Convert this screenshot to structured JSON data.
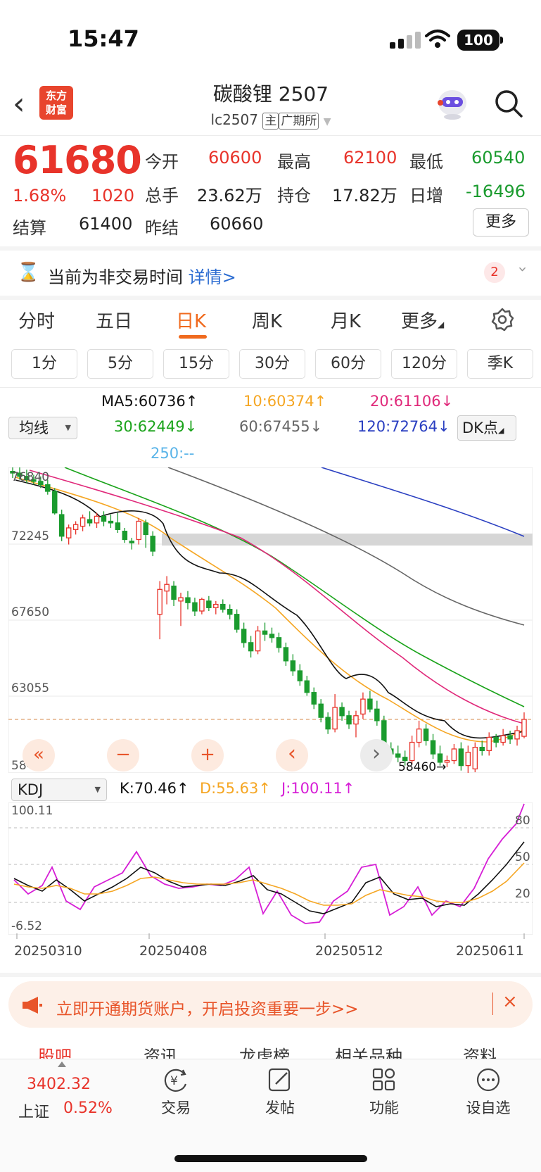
{
  "status_bar": {
    "time": "15:47",
    "battery": "100"
  },
  "header": {
    "logo_line1": "东方",
    "logo_line2": "财富",
    "title": "碳酸锂 2507",
    "code": "lc2507",
    "tag_main": "主",
    "tag_exchange": "广期所"
  },
  "quote": {
    "price": "61680",
    "change_pct": "1.68%",
    "change": "1020",
    "open_label": "今开",
    "open": "60600",
    "high_label": "最高",
    "high": "62100",
    "low_label": "最低",
    "low": "60540",
    "volume_label": "总手",
    "volume": "23.62万",
    "oi_label": "持仓",
    "oi": "17.82万",
    "daily_inc_label": "日增",
    "daily_inc": "-16496",
    "settle_label": "结算",
    "settle": "61400",
    "prev_settle_label": "昨结",
    "prev_settle": "60660",
    "more": "更多"
  },
  "notice": {
    "text": "当前为非交易时间",
    "link": "详情>",
    "count": "2"
  },
  "tabs": [
    "分时",
    "五日",
    "日K",
    "周K",
    "月K",
    "更多"
  ],
  "active_tab": "日K",
  "periods": [
    "1分",
    "5分",
    "15分",
    "30分",
    "60分",
    "120分",
    "季K"
  ],
  "ma_legend": {
    "select": "均线",
    "ma5": "MA5:60736↑",
    "ma10": "10:60374↑",
    "ma20": "20:61106↓",
    "ma30": "30:62449↓",
    "ma60": "60:67455↓",
    "ma120": "120:72764↓",
    "ma250": "250:--",
    "dk": "DK点"
  },
  "colors": {
    "up": "#e8332a",
    "down": "#1a9b2e",
    "ma5": "#111111",
    "ma10": "#f5a623",
    "ma20": "#e0297a",
    "ma30": "#1aa31a",
    "ma60": "#666666",
    "ma120": "#2a3fc1",
    "ma250": "#5ab4e8"
  },
  "price_axis": {
    "top": "76840",
    "l1": "72245",
    "l2": "67650",
    "l3": "63055",
    "bottom": "58460"
  },
  "low_marker": "58460→",
  "chart_controls": [
    "«",
    "−",
    "+",
    "‹",
    "›"
  ],
  "kdj": {
    "select": "KDJ",
    "k": "K:70.46↑",
    "d": "D:55.63↑",
    "j": "J:100.11↑",
    "top": "100.11",
    "bottom": "-6.52",
    "r80": "80",
    "r50": "50",
    "r20": "20"
  },
  "dates": [
    "20250310",
    "20250408",
    "20250512",
    "20250611"
  ],
  "chart_data": {
    "type": "candlestick",
    "ylim": [
      58460,
      76840
    ],
    "candles": [
      [
        76600,
        77000,
        76200,
        76500
      ],
      [
        76500,
        76900,
        76100,
        76300
      ],
      [
        76300,
        76700,
        75900,
        76100
      ],
      [
        76100,
        76400,
        75800,
        76000
      ],
      [
        76000,
        76300,
        75600,
        75800
      ],
      [
        75800,
        76100,
        75200,
        75400
      ],
      [
        75400,
        75600,
        74000,
        74100
      ],
      [
        74000,
        74300,
        72400,
        72700
      ],
      [
        72600,
        73400,
        72200,
        73200
      ],
      [
        73100,
        73600,
        72800,
        73400
      ],
      [
        73300,
        74000,
        73000,
        73800
      ],
      [
        73700,
        74200,
        73300,
        73500
      ],
      [
        73500,
        74100,
        73200,
        73900
      ],
      [
        73900,
        74200,
        73300,
        73600
      ],
      [
        73600,
        74000,
        73200,
        73500
      ],
      [
        73500,
        74100,
        72900,
        73100
      ],
      [
        73000,
        73200,
        72300,
        72500
      ],
      [
        72400,
        72600,
        71900,
        72300
      ],
      [
        72500,
        73800,
        72200,
        73600
      ],
      [
        73500,
        73700,
        72000,
        72800
      ],
      [
        72700,
        73000,
        71500,
        71800
      ],
      [
        68000,
        70000,
        66500,
        69500
      ],
      [
        69400,
        70300,
        68600,
        69800
      ],
      [
        69700,
        70000,
        68500,
        68900
      ],
      [
        68800,
        69300,
        67300,
        69000
      ],
      [
        69000,
        69400,
        68300,
        68700
      ],
      [
        68700,
        69000,
        67900,
        68200
      ],
      [
        68200,
        69000,
        68000,
        68900
      ],
      [
        68800,
        69100,
        68200,
        68400
      ],
      [
        68400,
        68800,
        68000,
        68600
      ],
      [
        68600,
        68900,
        68100,
        68300
      ],
      [
        68300,
        68600,
        67700,
        68000
      ],
      [
        68000,
        68300,
        66900,
        67100
      ],
      [
        67100,
        67500,
        66000,
        66300
      ],
      [
        66300,
        66700,
        65400,
        65800
      ],
      [
        65800,
        67300,
        65600,
        67000
      ],
      [
        67000,
        67500,
        66400,
        66800
      ],
      [
        66800,
        67200,
        66300,
        66600
      ],
      [
        66600,
        66900,
        65700,
        66000
      ],
      [
        66000,
        66300,
        64900,
        65200
      ],
      [
        65200,
        65600,
        64300,
        64600
      ],
      [
        64600,
        65000,
        63700,
        64000
      ],
      [
        64000,
        64300,
        63100,
        63300
      ],
      [
        63300,
        63600,
        62300,
        62600
      ],
      [
        62600,
        62900,
        61500,
        61800
      ],
      [
        61800,
        62100,
        60800,
        61100
      ],
      [
        61100,
        63200,
        60900,
        62400
      ],
      [
        62400,
        62700,
        61600,
        61900
      ],
      [
        61900,
        62200,
        61100,
        61400
      ],
      [
        61400,
        62200,
        60600,
        61900
      ],
      [
        62000,
        63300,
        61700,
        62900
      ],
      [
        62900,
        63400,
        62100,
        62300
      ],
      [
        62300,
        62800,
        61300,
        61600
      ],
      [
        61600,
        61900,
        59600,
        59900
      ],
      [
        59900,
        60300,
        59300,
        59600
      ],
      [
        59600,
        60100,
        59100,
        59400
      ],
      [
        59400,
        59800,
        58900,
        59200
      ],
      [
        59200,
        60700,
        59000,
        60300
      ],
      [
        60300,
        61600,
        60000,
        61100
      ],
      [
        61100,
        61400,
        60100,
        60400
      ],
      [
        60400,
        60800,
        59300,
        59600
      ],
      [
        59600,
        60100,
        58900,
        59100
      ],
      [
        59100,
        59500,
        58800,
        59200
      ],
      [
        59200,
        60200,
        59000,
        59900
      ],
      [
        59900,
        60300,
        58600,
        58900
      ],
      [
        58900,
        60100,
        58460,
        59700
      ],
      [
        58700,
        60300,
        58500,
        60000
      ],
      [
        60000,
        60400,
        59500,
        59800
      ],
      [
        59800,
        60900,
        59500,
        60600
      ],
      [
        60600,
        60800,
        60000,
        60300
      ],
      [
        60300,
        61100,
        60100,
        60700
      ],
      [
        60700,
        61000,
        60200,
        60500
      ],
      [
        60500,
        61300,
        60100,
        61000
      ],
      [
        60660,
        62100,
        60540,
        61680
      ]
    ]
  },
  "ad": {
    "text": "立即开通期货账户，开启投资重要一步>>",
    "close": "×"
  },
  "sub_tabs": [
    "股吧",
    "资讯",
    "龙虎榜",
    "相关品种",
    "资料"
  ],
  "bottom_nav": {
    "index_value": "3402.32",
    "index_name": "上证",
    "index_change": "0.52%",
    "items": [
      "交易",
      "发帖",
      "功能",
      "设自选"
    ]
  }
}
